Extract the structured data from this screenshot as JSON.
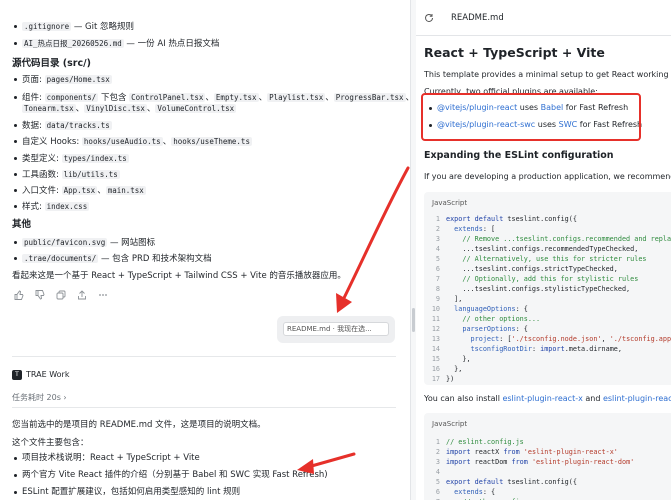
{
  "left": {
    "items_top": [
      {
        "code": ".gitignore",
        "text": " — Git 忽略规则"
      },
      {
        "code": "AI_热点日报_20260526.md",
        "text": " — 一份 AI 热点日报文档"
      }
    ],
    "src_heading": "源代码目录 (src/)",
    "src_items": {
      "page_label": "页面: ",
      "page_code": "pages/Home.tsx",
      "comp_label": "组件: ",
      "comp_code1": "components/",
      "comp_mid": " 下包含 ",
      "comp_code2": "ControlPanel.tsx",
      "comp_code3": "Empty.tsx",
      "comp_code4": "Playlist.tsx",
      "comp_code5": "ProgressBar.tsx",
      "comp_code6": "Tonearm.tsx",
      "comp_code7": "VinylDisc.tsx",
      "comp_code8": "VolumeControl.tsx",
      "sep": "、",
      "data_label": "数据: ",
      "data_code": "data/tracks.ts",
      "hooks_label": "自定义 Hooks: ",
      "hooks_code1": "hooks/useAudio.ts",
      "hooks_code2": "hooks/useTheme.ts",
      "types_label": "类型定义: ",
      "types_code": "types/index.ts",
      "utils_label": "工具函数: ",
      "utils_code": "lib/utils.ts",
      "entry_label": "入口文件: ",
      "entry_code1": "App.tsx",
      "entry_code2": "main.tsx",
      "style_label": "样式: ",
      "style_code": "index.css"
    },
    "other_heading": "其他",
    "other_items": [
      {
        "code": "public/favicon.svg",
        "text": " — 网站图标"
      },
      {
        "code": ".trae/documents/",
        "text": " — 包含 PRD 和技术架构文档"
      }
    ],
    "summary": "看起来这是一个基于 React + TypeScript + Tailwind CSS + Vite 的音乐播放器应用。",
    "chip_text": "README.md · 我现在选...",
    "agent_name": "TRAE Work",
    "task_time": "任务耗时 20s ›",
    "reply_intro": "您当前选中的是项目的 README.md 文件，这是项目的说明文档。",
    "reply_sub": "这个文件主要包含：",
    "reply_items": [
      "项目技术栈说明：React + TypeScript + Vite",
      "两个官方 Vite React 插件的介绍（分别基于 Babel 和 SWC 实现 Fast Refresh)",
      "ESLint 配置扩展建议，包括如何启用类型感知的 lint 规则"
    ]
  },
  "right": {
    "tab_title": "README.md",
    "h1": "React + TypeScript + Vite",
    "intro": "This template provides a minimal setup to get React working in Vite w",
    "plugins_line": "Currently, two official plugins are available:",
    "plugin1_link": "@vitejs/plugin-react",
    "plugin1_mid": " uses ",
    "plugin1_babel": "Babel",
    "plugin1_end": " for Fast Refresh",
    "plugin2_link": "@vitejs/plugin-react-swc",
    "plugin2_mid": " uses ",
    "plugin2_swc": "SWC",
    "plugin2_end": " for Fast Refresh",
    "h2": "Expanding the ESLint configuration",
    "eslint_intro": "If you are developing a production application, we recommend updat",
    "code1_lang": "JavaScript",
    "code2_lang": "JavaScript",
    "also_text": "You can also install ",
    "also_link1": "eslint-plugin-react-x",
    "also_and": " and ",
    "also_link2": "eslint-plugin-react-dom"
  },
  "colors": {
    "accent_red": "#e6302a",
    "link_blue": "#2f6fd1"
  }
}
